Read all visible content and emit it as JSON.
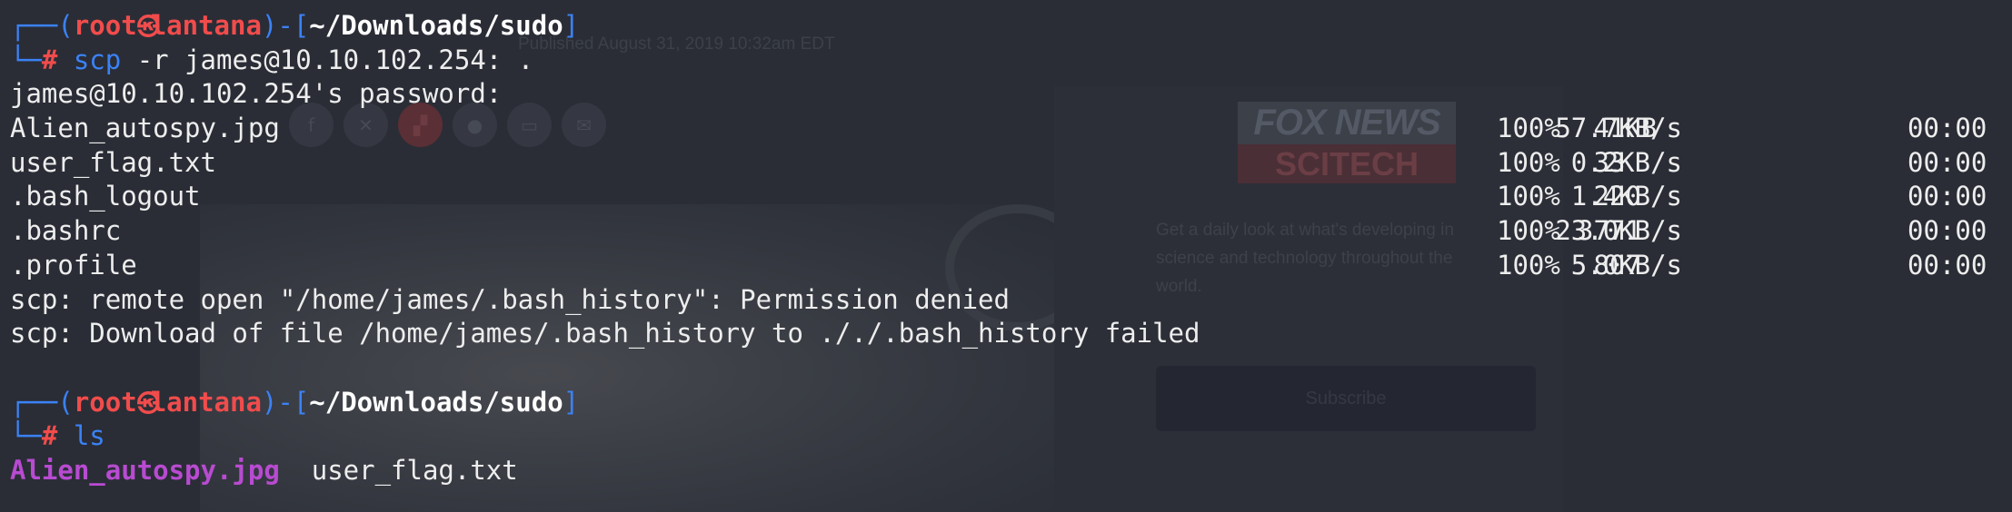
{
  "background_page": {
    "date_text": "Published August 31, 2019 10:32am EDT",
    "share_icons": [
      "facebook-icon",
      "twitter-icon",
      "flipboard-icon",
      "comments-icon",
      "print-icon",
      "email-icon"
    ],
    "logo_top": "FOX NEWS",
    "logo_bottom": "SCITECH",
    "blurb": "Get a daily look at what's developing in science and technology throughout the world.",
    "subscribe_label": "Subscribe"
  },
  "terminal": {
    "prompt1": {
      "user": "root",
      "skull": "㉿",
      "host": "lantana",
      "path": "~/Downloads/sudo",
      "command": "scp",
      "args": " -r james@10.10.102.254: ."
    },
    "password_prompt": "james@10.10.102.254's password:",
    "transfers": [
      {
        "file": "Alien_autospy.jpg",
        "percent": "100%",
        "size": " 41KB",
        "rate": "57.7KB/s",
        "time": "00:00"
      },
      {
        "file": "user_flag.txt",
        "percent": "100%",
        "size": " 33",
        "rate": "0.2KB/s",
        "time": "00:00"
      },
      {
        "file": ".bash_logout",
        "percent": "100%",
        "size": " 220",
        "rate": "1.4KB/s",
        "time": "00:00"
      },
      {
        "file": ".bashrc",
        "percent": "100%",
        "size": "3771",
        "rate": "23.0KB/s",
        "time": "00:00"
      },
      {
        "file": ".profile",
        "percent": "100%",
        "size": " 807",
        "rate": "5.0KB/s",
        "time": "00:00"
      }
    ],
    "errors": [
      "scp: remote open \"/home/james/.bash_history\": Permission denied",
      "scp: Download of file /home/james/.bash_history to ././.bash_history failed"
    ],
    "prompt2": {
      "user": "root",
      "skull": "㉿",
      "host": "lantana",
      "path": "~/Downloads/sudo",
      "command": "ls"
    },
    "ls_output": {
      "image_file": "Alien_autospy.jpg",
      "text_file": "user_flag.txt"
    },
    "colors": {
      "background": "#2a2d36",
      "prompt_frame": "#3b82f6",
      "prompt_user": "#f14c4c",
      "text": "#ededed",
      "image_file": "#b84bd1"
    }
  }
}
